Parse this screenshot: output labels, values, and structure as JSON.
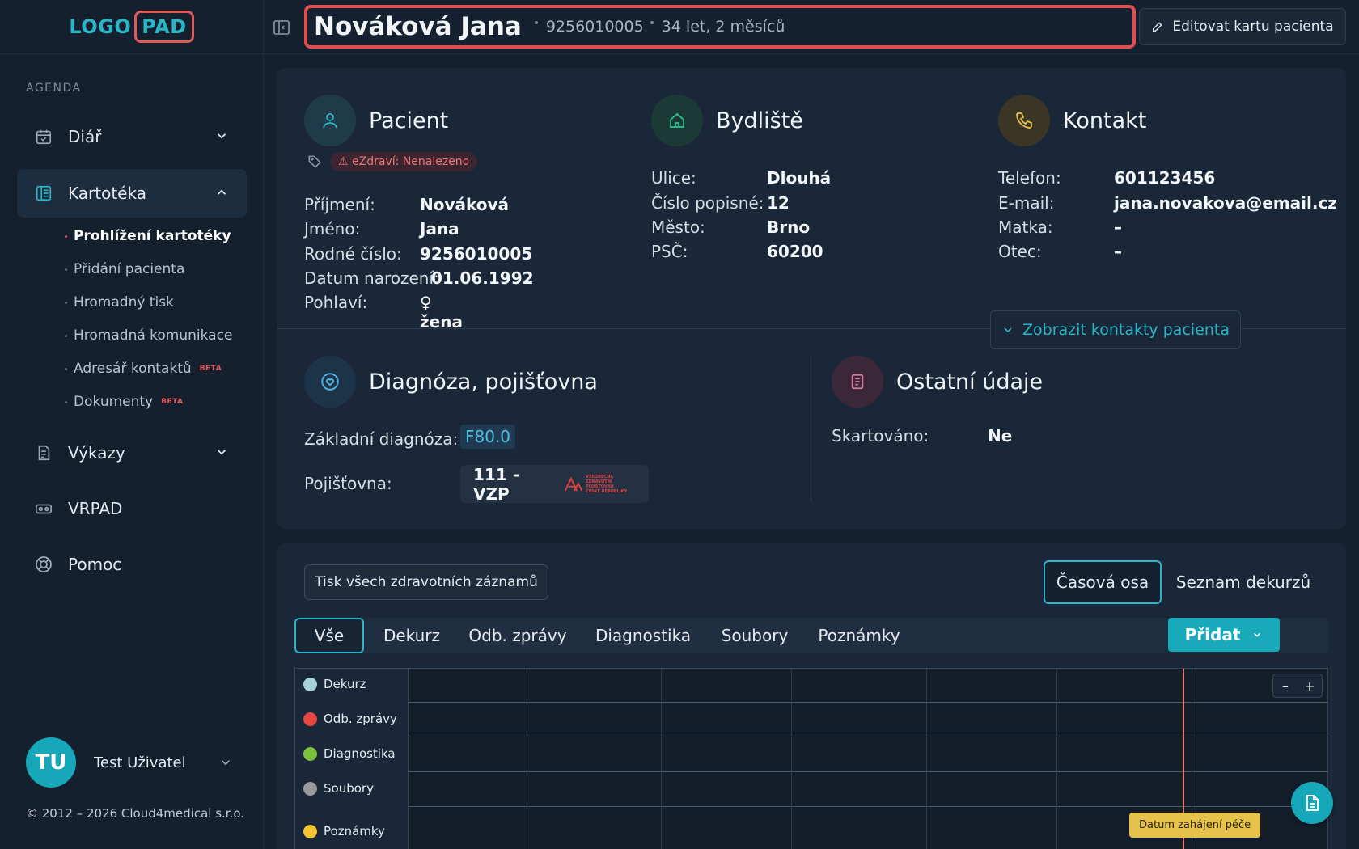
{
  "logo": {
    "part1": "LOGO",
    "part2": "PAD"
  },
  "sidebar": {
    "section_label": "AGENDA",
    "items": [
      {
        "label": "Diář",
        "icon": "calendar-icon"
      },
      {
        "label": "Kartotéka",
        "icon": "card-file-icon"
      },
      {
        "label": "Výkazy",
        "icon": "report-icon"
      },
      {
        "label": "VRPAD",
        "icon": "vr-headset-icon"
      },
      {
        "label": "Pomoc",
        "icon": "lifebuoy-icon"
      }
    ],
    "sub_items": [
      {
        "label": "Prohlížení kartotéky"
      },
      {
        "label": "Přidání pacienta"
      },
      {
        "label": "Hromadný tisk"
      },
      {
        "label": "Hromadná komunikace"
      },
      {
        "label": "Adresář kontaktů",
        "badge": "BETA"
      },
      {
        "label": "Dokumenty",
        "badge": "BETA"
      }
    ]
  },
  "user": {
    "initials": "TU",
    "name": "Test Uživatel"
  },
  "copyright": "© 2012 – 2026 Cloud4medical s.r.o.",
  "header": {
    "patient_name": "Nováková Jana",
    "birth_number": "9256010005",
    "age": "34 let, 2 měsíců",
    "edit_button": "Editovat kartu pacienta"
  },
  "patient": {
    "title": "Pacient",
    "ezdravi": "eZdraví: Nenalezeno",
    "fields": [
      {
        "k": "Příjmení:",
        "v": "Nováková"
      },
      {
        "k": "Jméno:",
        "v": "Jana"
      },
      {
        "k": "Rodné číslo:",
        "v": "9256010005"
      },
      {
        "k": "Datum narození:",
        "v": "01.06.1992"
      },
      {
        "k": "Pohlaví:",
        "v": "žena"
      }
    ]
  },
  "address": {
    "title": "Bydliště",
    "fields": [
      {
        "k": "Ulice:",
        "v": "Dlouhá"
      },
      {
        "k": "Číslo popisné:",
        "v": "12"
      },
      {
        "k": "Město:",
        "v": "Brno"
      },
      {
        "k": "PSČ:",
        "v": "60200"
      }
    ]
  },
  "contact": {
    "title": "Kontakt",
    "fields": [
      {
        "k": "Telefon:",
        "v": "601123456"
      },
      {
        "k": "E-mail:",
        "v": "jana.novakova@email.cz"
      },
      {
        "k": "Matka:",
        "v": "–"
      },
      {
        "k": "Otec:",
        "v": "–"
      }
    ],
    "show_contacts": "Zobrazit kontakty pacienta"
  },
  "diagnosis": {
    "title": "Diagnóza, pojišťovna",
    "base_label": "Základní diagnóza:",
    "base_value": "F80.0",
    "insurance_label": "Pojišťovna:",
    "insurance_value": "111 - VZP",
    "insurance_logo_text": [
      "VŠEOBECNÁ",
      "ZDRAVOTNÍ POJIŠŤOVNA",
      "ČESKÉ REPUBLIKY"
    ]
  },
  "other": {
    "title": "Ostatní údaje",
    "shredded_label": "Skartováno:",
    "shredded_value": "Ne"
  },
  "timeline": {
    "print_all": "Tisk všech zdravotních záznamů",
    "view_timeline": "Časová osa",
    "view_list": "Seznam dekurzů",
    "tabs": [
      "Vše",
      "Dekurz",
      "Odb. zprávy",
      "Diagnostika",
      "Soubory",
      "Poznámky"
    ],
    "add_button": "Přidat",
    "rows": [
      {
        "label": "Dekurz",
        "color": "#a9d3dc"
      },
      {
        "label": "Odb. zprávy",
        "color": "#e6473f"
      },
      {
        "label": "Diagnostika",
        "color": "#7cc23c"
      },
      {
        "label": "Soubory",
        "color": "#9a9a9a"
      },
      {
        "label": "Poznámky",
        "color": "#f2c531"
      }
    ],
    "zoom_out": "–",
    "zoom_in": "+",
    "start_flag": "Datum zahájení péče"
  },
  "colors": {
    "accent": "#16a8b8",
    "danger": "#e24d4d",
    "background": "#15202e"
  }
}
